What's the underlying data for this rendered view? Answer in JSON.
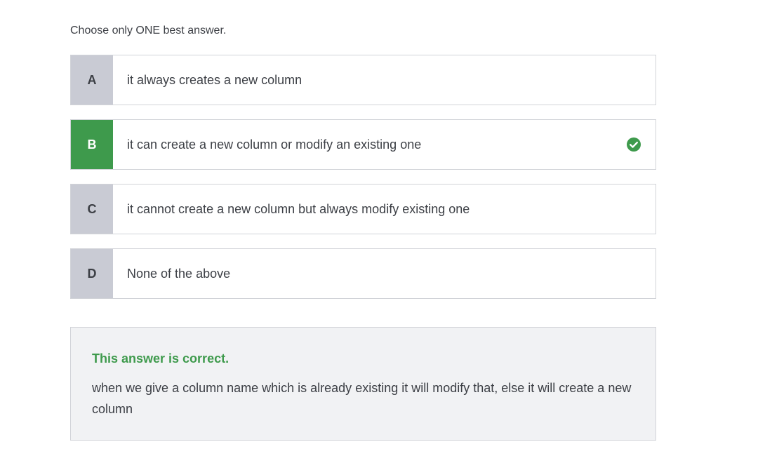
{
  "instruction": "Choose only ONE best answer.",
  "options": [
    {
      "letter": "A",
      "text": "it always creates a new column",
      "state": "default"
    },
    {
      "letter": "B",
      "text": "it can create a new column or modify an existing one",
      "state": "correct"
    },
    {
      "letter": "C",
      "text": "it cannot create a new column but always modify existing one",
      "state": "default"
    },
    {
      "letter": "D",
      "text": "None of the above",
      "state": "default"
    }
  ],
  "feedback": {
    "title": "This answer is correct.",
    "body": "when we give a column name which is already existing it will modify that, else it will create a new column"
  },
  "colors": {
    "correct": "#3e9a4c",
    "letter_bg": "#c9cbd4",
    "feedback_bg": "#f1f2f4"
  }
}
